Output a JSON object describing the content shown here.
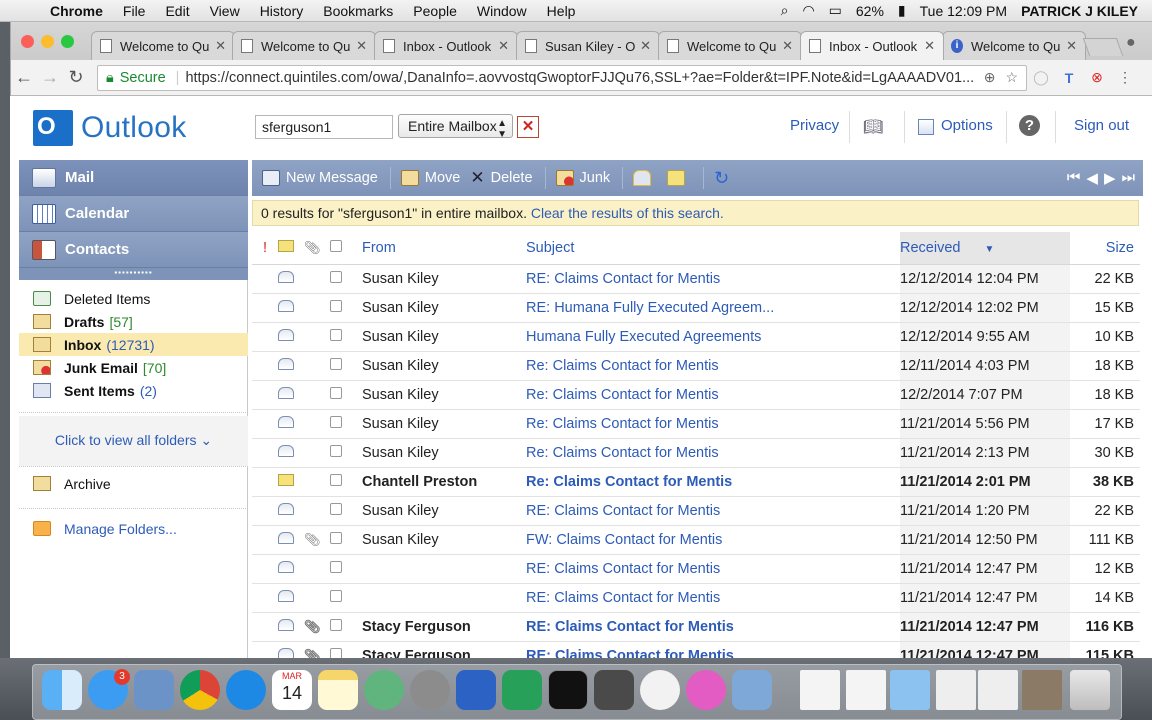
{
  "menubar": {
    "app": "Chrome",
    "items": [
      "File",
      "Edit",
      "View",
      "History",
      "Bookmarks",
      "People",
      "Window",
      "Help"
    ],
    "battery": "62%",
    "clock": "Tue 12:09 PM",
    "user": "PATRICK J KILEY"
  },
  "tabs": [
    {
      "label": "Welcome to Qu",
      "icon": "page-icon"
    },
    {
      "label": "Welcome to Qu",
      "icon": "page-icon"
    },
    {
      "label": "Inbox - Outlook",
      "icon": "page-icon"
    },
    {
      "label": "Susan Kiley - O",
      "icon": "page-icon"
    },
    {
      "label": "Welcome to Qu",
      "icon": "page-icon"
    },
    {
      "label": "Inbox - Outlook",
      "icon": "page-icon",
      "active": true
    },
    {
      "label": "Welcome to Qu",
      "icon": "info-icon"
    }
  ],
  "address": {
    "secure_label": "Secure",
    "url": "https://connect.quintiles.com/owa/,DanaInfo=.aovvostqGwoptorFJJQu76,SSL+?ae=Folder&t=IPF.Note&id=LgAAAADV01..."
  },
  "header": {
    "logo_text": "Outlook",
    "search_value": "sferguson1",
    "scope": "Entire Mailbox",
    "links": {
      "privacy": "Privacy",
      "options": "Options",
      "signout": "Sign out"
    }
  },
  "nav": {
    "buttons": {
      "mail": "Mail",
      "calendar": "Calendar",
      "contacts": "Contacts"
    },
    "folders": [
      {
        "name": "Deleted Items",
        "count": "",
        "bold": false
      },
      {
        "name": "Drafts",
        "count": "[57]",
        "bold": true
      },
      {
        "name": "Inbox",
        "count": "(12731)",
        "bold": true,
        "selected": true
      },
      {
        "name": "Junk Email",
        "count": "[70]",
        "bold": true
      },
      {
        "name": "Sent Items",
        "count": "(2)",
        "bold": true
      }
    ],
    "view_all": "Click to view all folders",
    "archive": "Archive",
    "manage": "Manage Folders..."
  },
  "toolbar": {
    "new_message": "New Message",
    "move": "Move",
    "delete": "Delete",
    "junk": "Junk"
  },
  "infobar": {
    "text": "0 results for \"sferguson1\" in entire mailbox.",
    "clear": "Clear the results of this search."
  },
  "columns": {
    "from": "From",
    "subject": "Subject",
    "received": "Received",
    "size": "Size"
  },
  "messages": [
    {
      "from": "Susan Kiley",
      "subject": "RE: Claims Contact for Mentis",
      "received": "12/12/2014 12:04 PM",
      "size": "22 KB",
      "icon": "open",
      "attach": false,
      "unread": false
    },
    {
      "from": "Susan Kiley",
      "subject": "RE: Humana Fully Executed Agreem...",
      "received": "12/12/2014 12:02 PM",
      "size": "15 KB",
      "icon": "open",
      "attach": false,
      "unread": false
    },
    {
      "from": "Susan Kiley",
      "subject": "Humana Fully Executed Agreements",
      "received": "12/12/2014 9:55 AM",
      "size": "10 KB",
      "icon": "open",
      "attach": false,
      "unread": false
    },
    {
      "from": "Susan Kiley",
      "subject": "Re: Claims Contact for Mentis",
      "received": "12/11/2014 4:03 PM",
      "size": "18 KB",
      "icon": "open",
      "attach": false,
      "unread": false
    },
    {
      "from": "Susan Kiley",
      "subject": "Re: Claims Contact for Mentis",
      "received": "12/2/2014 7:07 PM",
      "size": "18 KB",
      "icon": "open",
      "attach": false,
      "unread": false
    },
    {
      "from": "Susan Kiley",
      "subject": "Re: Claims Contact for Mentis",
      "received": "11/21/2014 5:56 PM",
      "size": "17 KB",
      "icon": "open",
      "attach": false,
      "unread": false
    },
    {
      "from": "Susan Kiley",
      "subject": "Re: Claims Contact for Mentis",
      "received": "11/21/2014 2:13 PM",
      "size": "30 KB",
      "icon": "open",
      "attach": false,
      "unread": false
    },
    {
      "from": "Chantell Preston",
      "subject": "Re: Claims Contact for Mentis",
      "received": "11/21/2014 2:01 PM",
      "size": "38 KB",
      "icon": "new",
      "attach": false,
      "unread": true
    },
    {
      "from": "Susan Kiley",
      "subject": "RE: Claims Contact for Mentis",
      "received": "11/21/2014 1:20 PM",
      "size": "22 KB",
      "icon": "open",
      "attach": false,
      "unread": false
    },
    {
      "from": "Susan Kiley",
      "subject": "FW: Claims Contact for Mentis",
      "received": "11/21/2014 12:50 PM",
      "size": "111 KB",
      "icon": "open",
      "attach": true,
      "unread": false
    },
    {
      "from": "",
      "subject": "RE: Claims Contact for Mentis",
      "received": "11/21/2014 12:47 PM",
      "size": "12 KB",
      "icon": "open",
      "attach": false,
      "unread": false
    },
    {
      "from": "",
      "subject": "RE: Claims Contact for Mentis",
      "received": "11/21/2014 12:47 PM",
      "size": "14 KB",
      "icon": "open",
      "attach": false,
      "unread": false
    },
    {
      "from": "Stacy Ferguson",
      "subject": "RE: Claims Contact for Mentis",
      "received": "11/21/2014 12:47 PM",
      "size": "116 KB",
      "icon": "forward",
      "attach": true,
      "unread": true
    },
    {
      "from": "Stacy Ferguson",
      "subject": "RE: Claims Contact for Mentis",
      "received": "11/21/2014 12:47 PM",
      "size": "115 KB",
      "icon": "open",
      "attach": true,
      "unread": true
    }
  ],
  "dock": {
    "calendar_month": "MAR",
    "calendar_day": "14",
    "appstore_badge": "3"
  },
  "colors": {
    "nav_blue": "#7e93b8",
    "link": "#2d5bb8",
    "selected_folder": "#faeab0",
    "infobar": "#fbf1c7"
  }
}
